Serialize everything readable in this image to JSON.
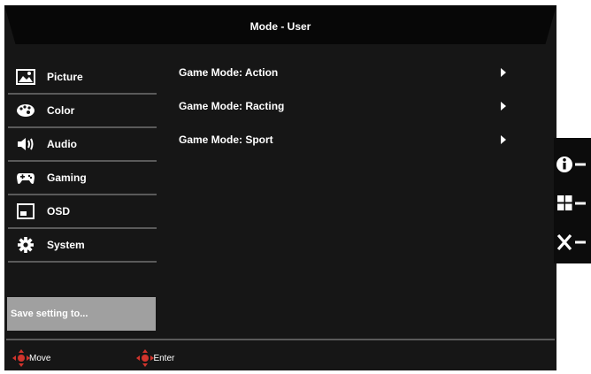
{
  "title": "Mode - User",
  "sidebar": {
    "items": [
      {
        "label": "Picture",
        "icon": "picture-icon"
      },
      {
        "label": "Color",
        "icon": "palette-icon"
      },
      {
        "label": "Audio",
        "icon": "speaker-icon"
      },
      {
        "label": "Gaming",
        "icon": "gamepad-icon"
      },
      {
        "label": "OSD",
        "icon": "osd-window-icon"
      },
      {
        "label": "System",
        "icon": "gear-icon"
      }
    ],
    "save_label": "Save setting to..."
  },
  "content": {
    "rows": [
      {
        "label": "Game Mode: Action"
      },
      {
        "label": "Game Mode: Racting"
      },
      {
        "label": "Game Mode: Sport"
      }
    ]
  },
  "footer": {
    "move_label": "Move",
    "enter_label": "Enter"
  },
  "hotkeys": [
    {
      "icon": "info-icon"
    },
    {
      "icon": "grid-icon"
    },
    {
      "icon": "close-icon"
    }
  ],
  "colors": {
    "background": "#161616",
    "title_bar": "#070707",
    "divider": "#5a5a5a",
    "save_button": "#a0a0a0",
    "nav_accent": "#d0342c",
    "text": "#ffffff"
  }
}
